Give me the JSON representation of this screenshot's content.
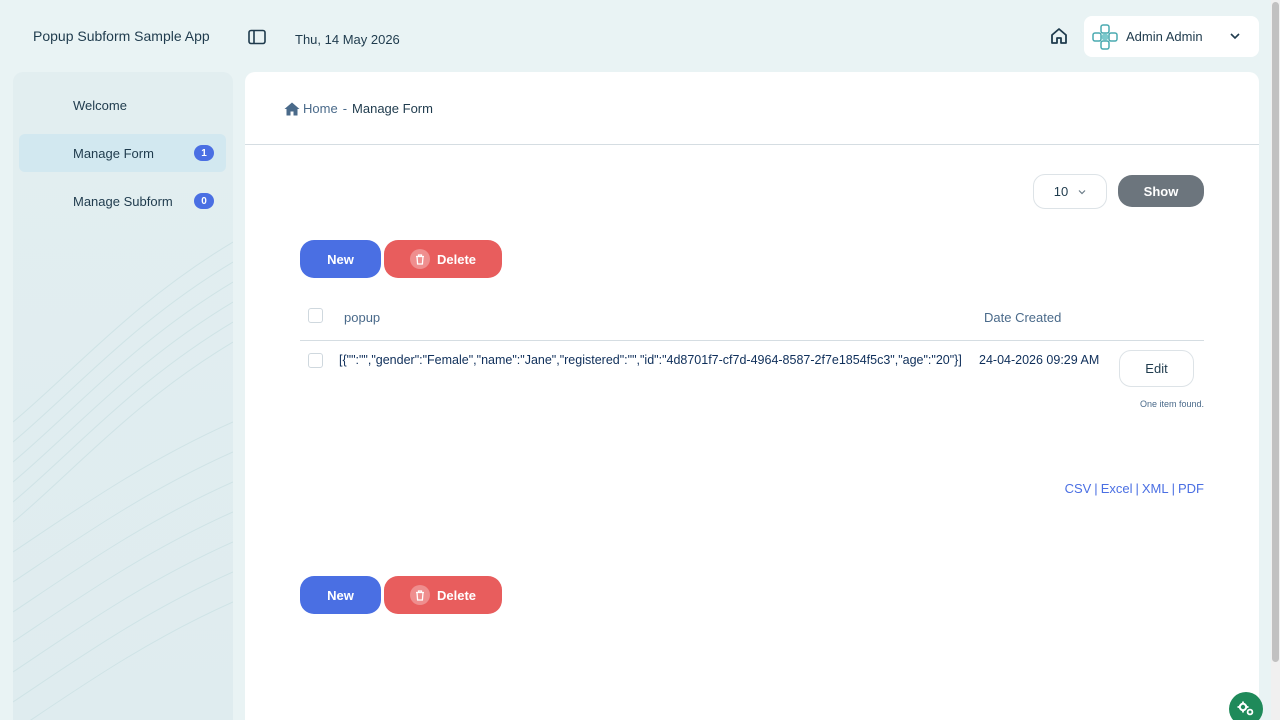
{
  "header": {
    "app_title": "Popup Subform Sample App",
    "date": "Thu, 14 May 2026",
    "user_name": "Admin Admin"
  },
  "sidebar": {
    "items": [
      {
        "label": "Welcome",
        "badge": null,
        "active": false
      },
      {
        "label": "Manage Form",
        "badge": "1",
        "active": true
      },
      {
        "label": "Manage Subform",
        "badge": "0",
        "active": false
      }
    ]
  },
  "breadcrumb": {
    "home": "Home",
    "separator": "-",
    "current": "Manage Form"
  },
  "toolbar": {
    "per_page": "10",
    "show_label": "Show",
    "new_label": "New",
    "delete_label": "Delete"
  },
  "table": {
    "headers": [
      "popup",
      "Date Created"
    ],
    "rows": [
      {
        "popup": "[{\"\":\"\",\"gender\":\"Female\",\"name\":\"Jane\",\"registered\":\"\",\"id\":\"4d8701f7-cf7d-4964-8587-2f7e1854f5c3\",\"age\":\"20\"}]",
        "date_created": "24-04-2026 09:29 AM",
        "edit_label": "Edit"
      }
    ],
    "found_text": "One item found."
  },
  "exports": [
    "CSV",
    "Excel",
    "XML",
    "PDF"
  ],
  "colors": {
    "primary": "#4a6fe3",
    "danger": "#e85d5d",
    "secondary": "#6c757d",
    "background": "#e9f3f4",
    "fab": "#1f8a5a"
  }
}
